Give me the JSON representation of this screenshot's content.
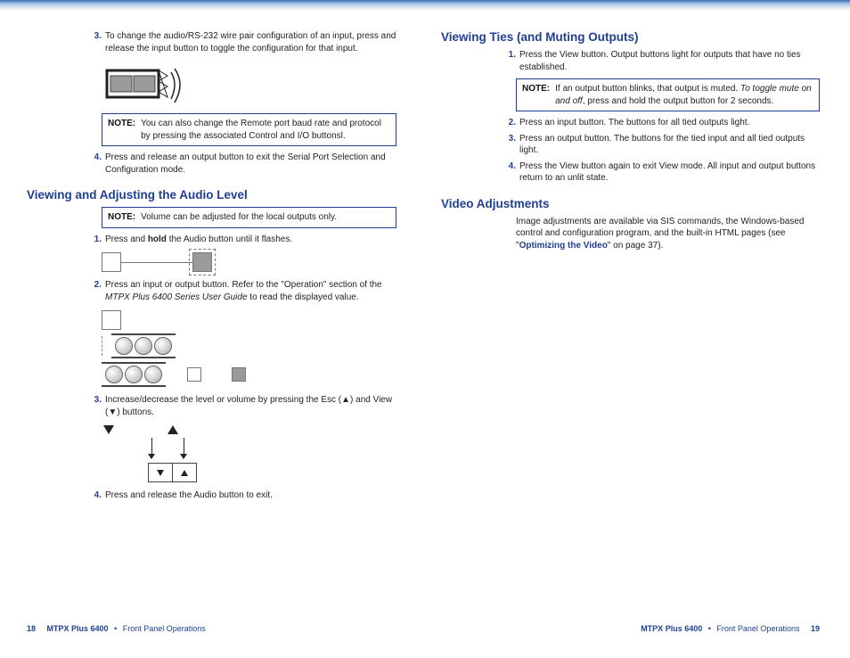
{
  "left": {
    "step3": "To change the audio/RS-232 wire pair configuration of an input, press and release the input button to toggle the configuration for that input.",
    "note1": "You can also change the Remote port baud rate and protocol by pressing the associated Control and I/O buttonsl.",
    "step4": "Press and release an output button to exit the Serial Port Selection and Configuration mode.",
    "heading1": "Viewing and Adjusting the Audio Level",
    "note2": "Volume can be adjusted for the local outputs only.",
    "step_a1_pre": "Press and ",
    "step_a1_bold": "hold",
    "step_a1_post": " the Audio button until it flashes.",
    "step_a2_pre": "Press an input or output button.  Refer to the \"Operation\" section of the ",
    "step_a2_italic": "MTPX Plus 6400 Series User Guide",
    "step_a2_post": " to read the displayed value.",
    "step_a3": "Increase/decrease the level or volume by pressing the Esc (▲) and View (▼) buttons.",
    "step_a4": "Press and release the Audio button to exit.",
    "footer_page": "18",
    "footer_title": "MTPX Plus 6400",
    "footer_section": "Front Panel Operations"
  },
  "right": {
    "heading1": "Viewing Ties (and Muting Outputs)",
    "step1": "Press the View button. Output buttons light for outputs that have no ties established.",
    "note1_pre": "If an output button blinks, that output is muted. ",
    "note1_italic": "To toggle mute on and off",
    "note1_post": ", press and hold the output button for 2 seconds.",
    "step2": "Press an input button. The buttons for all tied outputs light.",
    "step3": "Press an output button. The buttons for the tied input and all tied outputs light.",
    "step4": "Press the View button again to exit View mode. All input and output buttons return to an unlit state.",
    "heading2": "Video Adjustments",
    "video_pre": "Image adjustments are available via SIS commands, the Windows-based control and configuration program, and the built-in HTML pages (see \"",
    "video_link": "Optimizing the Video",
    "video_post": "\" on page 37).",
    "footer_title": "MTPX Plus 6400",
    "footer_section": "Front Panel Operations",
    "footer_page": "19"
  },
  "labels": {
    "note": "NOTE:",
    "n1": "1.",
    "n2": "2.",
    "n3": "3.",
    "n4": "4."
  }
}
